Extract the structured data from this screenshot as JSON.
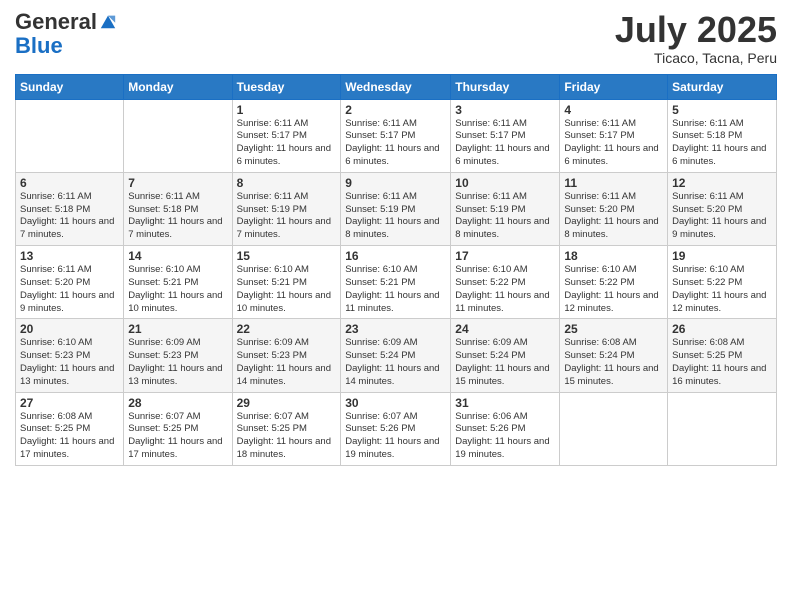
{
  "logo": {
    "general": "General",
    "blue": "Blue"
  },
  "title": "July 2025",
  "location": "Ticaco, Tacna, Peru",
  "headers": [
    "Sunday",
    "Monday",
    "Tuesday",
    "Wednesday",
    "Thursday",
    "Friday",
    "Saturday"
  ],
  "weeks": [
    [
      {
        "day": "",
        "sunrise": "",
        "sunset": "",
        "daylight": ""
      },
      {
        "day": "",
        "sunrise": "",
        "sunset": "",
        "daylight": ""
      },
      {
        "day": "1",
        "sunrise": "Sunrise: 6:11 AM",
        "sunset": "Sunset: 5:17 PM",
        "daylight": "Daylight: 11 hours and 6 minutes."
      },
      {
        "day": "2",
        "sunrise": "Sunrise: 6:11 AM",
        "sunset": "Sunset: 5:17 PM",
        "daylight": "Daylight: 11 hours and 6 minutes."
      },
      {
        "day": "3",
        "sunrise": "Sunrise: 6:11 AM",
        "sunset": "Sunset: 5:17 PM",
        "daylight": "Daylight: 11 hours and 6 minutes."
      },
      {
        "day": "4",
        "sunrise": "Sunrise: 6:11 AM",
        "sunset": "Sunset: 5:17 PM",
        "daylight": "Daylight: 11 hours and 6 minutes."
      },
      {
        "day": "5",
        "sunrise": "Sunrise: 6:11 AM",
        "sunset": "Sunset: 5:18 PM",
        "daylight": "Daylight: 11 hours and 6 minutes."
      }
    ],
    [
      {
        "day": "6",
        "sunrise": "Sunrise: 6:11 AM",
        "sunset": "Sunset: 5:18 PM",
        "daylight": "Daylight: 11 hours and 7 minutes."
      },
      {
        "day": "7",
        "sunrise": "Sunrise: 6:11 AM",
        "sunset": "Sunset: 5:18 PM",
        "daylight": "Daylight: 11 hours and 7 minutes."
      },
      {
        "day": "8",
        "sunrise": "Sunrise: 6:11 AM",
        "sunset": "Sunset: 5:19 PM",
        "daylight": "Daylight: 11 hours and 7 minutes."
      },
      {
        "day": "9",
        "sunrise": "Sunrise: 6:11 AM",
        "sunset": "Sunset: 5:19 PM",
        "daylight": "Daylight: 11 hours and 8 minutes."
      },
      {
        "day": "10",
        "sunrise": "Sunrise: 6:11 AM",
        "sunset": "Sunset: 5:19 PM",
        "daylight": "Daylight: 11 hours and 8 minutes."
      },
      {
        "day": "11",
        "sunrise": "Sunrise: 6:11 AM",
        "sunset": "Sunset: 5:20 PM",
        "daylight": "Daylight: 11 hours and 8 minutes."
      },
      {
        "day": "12",
        "sunrise": "Sunrise: 6:11 AM",
        "sunset": "Sunset: 5:20 PM",
        "daylight": "Daylight: 11 hours and 9 minutes."
      }
    ],
    [
      {
        "day": "13",
        "sunrise": "Sunrise: 6:11 AM",
        "sunset": "Sunset: 5:20 PM",
        "daylight": "Daylight: 11 hours and 9 minutes."
      },
      {
        "day": "14",
        "sunrise": "Sunrise: 6:10 AM",
        "sunset": "Sunset: 5:21 PM",
        "daylight": "Daylight: 11 hours and 10 minutes."
      },
      {
        "day": "15",
        "sunrise": "Sunrise: 6:10 AM",
        "sunset": "Sunset: 5:21 PM",
        "daylight": "Daylight: 11 hours and 10 minutes."
      },
      {
        "day": "16",
        "sunrise": "Sunrise: 6:10 AM",
        "sunset": "Sunset: 5:21 PM",
        "daylight": "Daylight: 11 hours and 11 minutes."
      },
      {
        "day": "17",
        "sunrise": "Sunrise: 6:10 AM",
        "sunset": "Sunset: 5:22 PM",
        "daylight": "Daylight: 11 hours and 11 minutes."
      },
      {
        "day": "18",
        "sunrise": "Sunrise: 6:10 AM",
        "sunset": "Sunset: 5:22 PM",
        "daylight": "Daylight: 11 hours and 12 minutes."
      },
      {
        "day": "19",
        "sunrise": "Sunrise: 6:10 AM",
        "sunset": "Sunset: 5:22 PM",
        "daylight": "Daylight: 11 hours and 12 minutes."
      }
    ],
    [
      {
        "day": "20",
        "sunrise": "Sunrise: 6:10 AM",
        "sunset": "Sunset: 5:23 PM",
        "daylight": "Daylight: 11 hours and 13 minutes."
      },
      {
        "day": "21",
        "sunrise": "Sunrise: 6:09 AM",
        "sunset": "Sunset: 5:23 PM",
        "daylight": "Daylight: 11 hours and 13 minutes."
      },
      {
        "day": "22",
        "sunrise": "Sunrise: 6:09 AM",
        "sunset": "Sunset: 5:23 PM",
        "daylight": "Daylight: 11 hours and 14 minutes."
      },
      {
        "day": "23",
        "sunrise": "Sunrise: 6:09 AM",
        "sunset": "Sunset: 5:24 PM",
        "daylight": "Daylight: 11 hours and 14 minutes."
      },
      {
        "day": "24",
        "sunrise": "Sunrise: 6:09 AM",
        "sunset": "Sunset: 5:24 PM",
        "daylight": "Daylight: 11 hours and 15 minutes."
      },
      {
        "day": "25",
        "sunrise": "Sunrise: 6:08 AM",
        "sunset": "Sunset: 5:24 PM",
        "daylight": "Daylight: 11 hours and 15 minutes."
      },
      {
        "day": "26",
        "sunrise": "Sunrise: 6:08 AM",
        "sunset": "Sunset: 5:25 PM",
        "daylight": "Daylight: 11 hours and 16 minutes."
      }
    ],
    [
      {
        "day": "27",
        "sunrise": "Sunrise: 6:08 AM",
        "sunset": "Sunset: 5:25 PM",
        "daylight": "Daylight: 11 hours and 17 minutes."
      },
      {
        "day": "28",
        "sunrise": "Sunrise: 6:07 AM",
        "sunset": "Sunset: 5:25 PM",
        "daylight": "Daylight: 11 hours and 17 minutes."
      },
      {
        "day": "29",
        "sunrise": "Sunrise: 6:07 AM",
        "sunset": "Sunset: 5:25 PM",
        "daylight": "Daylight: 11 hours and 18 minutes."
      },
      {
        "day": "30",
        "sunrise": "Sunrise: 6:07 AM",
        "sunset": "Sunset: 5:26 PM",
        "daylight": "Daylight: 11 hours and 19 minutes."
      },
      {
        "day": "31",
        "sunrise": "Sunrise: 6:06 AM",
        "sunset": "Sunset: 5:26 PM",
        "daylight": "Daylight: 11 hours and 19 minutes."
      },
      {
        "day": "",
        "sunrise": "",
        "sunset": "",
        "daylight": ""
      },
      {
        "day": "",
        "sunrise": "",
        "sunset": "",
        "daylight": ""
      }
    ]
  ]
}
